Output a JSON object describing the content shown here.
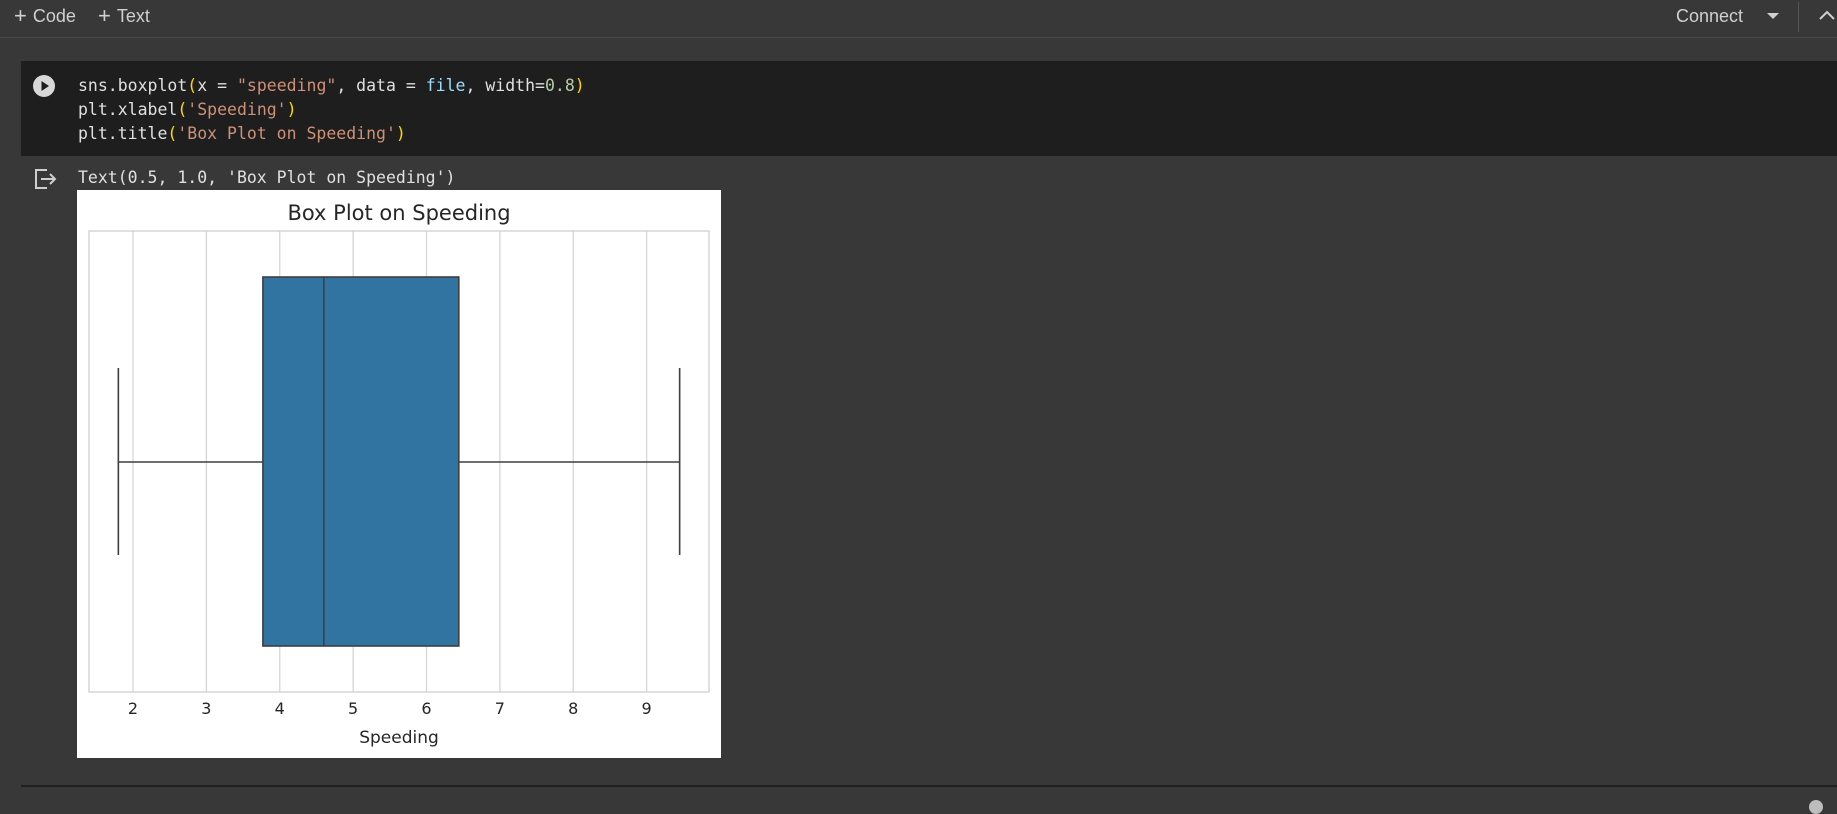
{
  "toolbar": {
    "add_code_label": "Code",
    "add_text_label": "Text",
    "connect_label": "Connect"
  },
  "cell": {
    "code_lines": [
      {
        "prefix": "sns.boxplot",
        "open": "(",
        "body_a": "x = ",
        "str_a": "\"speeding\"",
        "body_b": ", data = ",
        "var": "file",
        "body_c": ", width=",
        "num": "0.8",
        "close": ")"
      },
      {
        "prefix": "plt.xlabel",
        "open": "(",
        "str": "'Speeding'",
        "close": ")"
      },
      {
        "prefix": "plt.title",
        "open": "(",
        "str": "'Box Plot on Speeding'",
        "close": ")"
      }
    ]
  },
  "output": {
    "text_repr": "Text(0.5, 1.0, 'Box Plot on Speeding')"
  },
  "chart_data": {
    "type": "box",
    "orientation": "horizontal",
    "title": "Box Plot on Speeding",
    "xlabel": "Speeding",
    "ylabel": "",
    "xlim": [
      1.4,
      9.85
    ],
    "xticks": [
      2,
      3,
      4,
      5,
      6,
      7,
      8,
      9
    ],
    "grid": true,
    "box": {
      "whisker_low": 1.8,
      "q1": 3.77,
      "median": 4.6,
      "q3": 6.44,
      "whisker_high": 9.45
    },
    "box_color": "#3274a1"
  }
}
